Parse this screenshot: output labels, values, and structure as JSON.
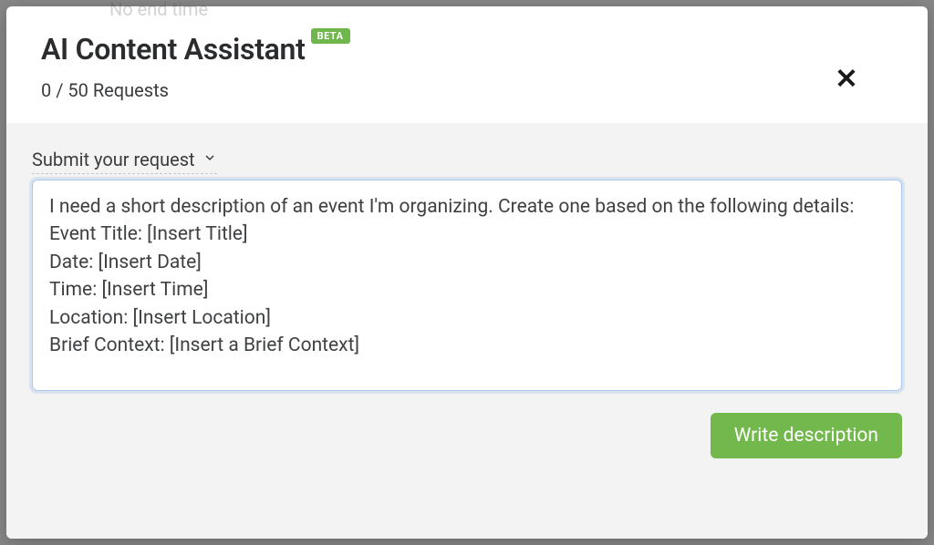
{
  "background": {
    "partial_text": "No end time"
  },
  "modal": {
    "title": "AI Content Assistant",
    "badge": "BETA",
    "requests_used": 0,
    "requests_total": 50,
    "requests_label": "Requests",
    "requests_line": "0 / 50 Requests",
    "body": {
      "section_label": "Submit your request",
      "textarea_value": "I need a short description of an event I'm organizing. Create one based on the following details:\nEvent Title: [Insert Title]\nDate: [Insert Date]\nTime: [Insert Time]\nLocation: [Insert Location]\nBrief Context: [Insert a Brief Context]",
      "write_button": "Write description"
    }
  }
}
